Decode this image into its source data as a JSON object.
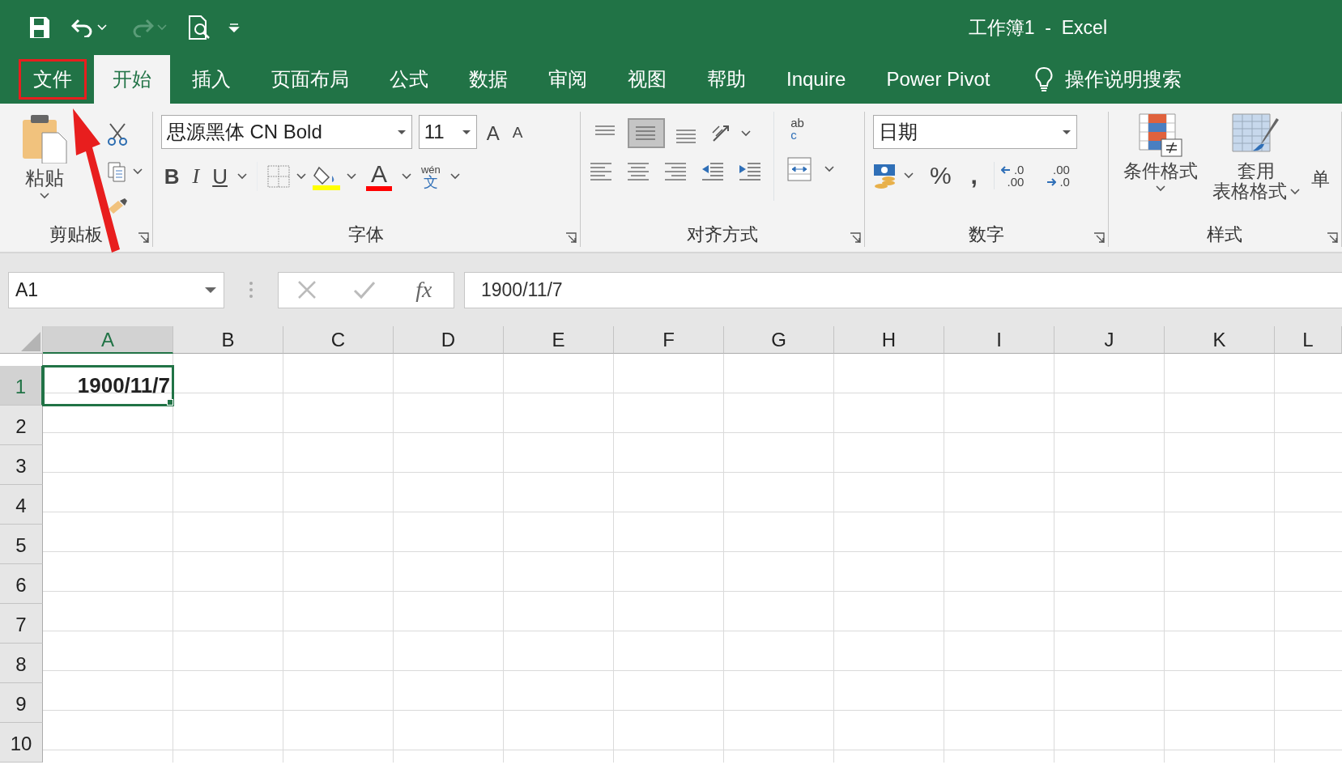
{
  "quick_access": {
    "redo_disabled": true
  },
  "title": "工作簿1  -  Excel",
  "tabs": [
    {
      "label": "文件",
      "selected": false,
      "outlined": true
    },
    {
      "label": "开始",
      "selected": true,
      "outlined": false
    },
    {
      "label": "插入",
      "selected": false,
      "outlined": false
    },
    {
      "label": "页面布局",
      "selected": false,
      "outlined": false
    },
    {
      "label": "公式",
      "selected": false,
      "outlined": false
    },
    {
      "label": "数据",
      "selected": false,
      "outlined": false
    },
    {
      "label": "审阅",
      "selected": false,
      "outlined": false
    },
    {
      "label": "视图",
      "selected": false,
      "outlined": false
    },
    {
      "label": "帮助",
      "selected": false,
      "outlined": false
    },
    {
      "label": "Inquire",
      "selected": false,
      "outlined": false
    },
    {
      "label": "Power Pivot",
      "selected": false,
      "outlined": false
    }
  ],
  "tell_me": "操作说明搜索",
  "annotation_arrow": true,
  "ribbon": {
    "clipboard": {
      "paste": "粘贴",
      "label": "剪贴板"
    },
    "font": {
      "font_name": "思源黑体 CN Bold",
      "font_size": "11",
      "grow": "A",
      "shrink": "A",
      "bold": "B",
      "italic": "I",
      "underline": "U",
      "font_color": "A",
      "phonetic_top": "wén",
      "phonetic_bottom": "文",
      "label": "字体"
    },
    "alignment": {
      "vertical": [
        {
          "selected": false
        },
        {
          "selected": true
        },
        {
          "selected": false
        }
      ],
      "wrap_top": "ab",
      "wrap_bottom": "c",
      "label": "对齐方式"
    },
    "number": {
      "format": "日期",
      "percent": "%",
      "comma": ",",
      "increase_decimal": [
        ".0",
        ".00"
      ],
      "decrease_decimal": [
        ".00",
        ".0"
      ],
      "label": "数字"
    },
    "styles": {
      "conditional": "条件格式",
      "table_lines": [
        "套用",
        "表格格式"
      ],
      "cell_styles": "单",
      "label": "样式"
    }
  },
  "name_box": "A1",
  "fx": "fx",
  "formula": "1900/11/7",
  "columns": [
    {
      "label": "A",
      "selected": true
    },
    {
      "label": "B",
      "selected": false
    },
    {
      "label": "C",
      "selected": false
    },
    {
      "label": "D",
      "selected": false
    },
    {
      "label": "E",
      "selected": false
    },
    {
      "label": "F",
      "selected": false
    },
    {
      "label": "G",
      "selected": false
    },
    {
      "label": "H",
      "selected": false
    },
    {
      "label": "I",
      "selected": false
    },
    {
      "label": "J",
      "selected": false
    },
    {
      "label": "K",
      "selected": false
    },
    {
      "label": "L",
      "selected": false
    }
  ],
  "rows": [
    {
      "label": "1",
      "selected": true,
      "cells": [
        "1900/11/7"
      ]
    },
    {
      "label": "2",
      "selected": false
    },
    {
      "label": "3",
      "selected": false
    },
    {
      "label": "4",
      "selected": false
    },
    {
      "label": "5",
      "selected": false
    },
    {
      "label": "6",
      "selected": false
    },
    {
      "label": "7",
      "selected": false
    },
    {
      "label": "8",
      "selected": false
    },
    {
      "label": "9",
      "selected": false
    },
    {
      "label": "10",
      "selected": false
    }
  ]
}
